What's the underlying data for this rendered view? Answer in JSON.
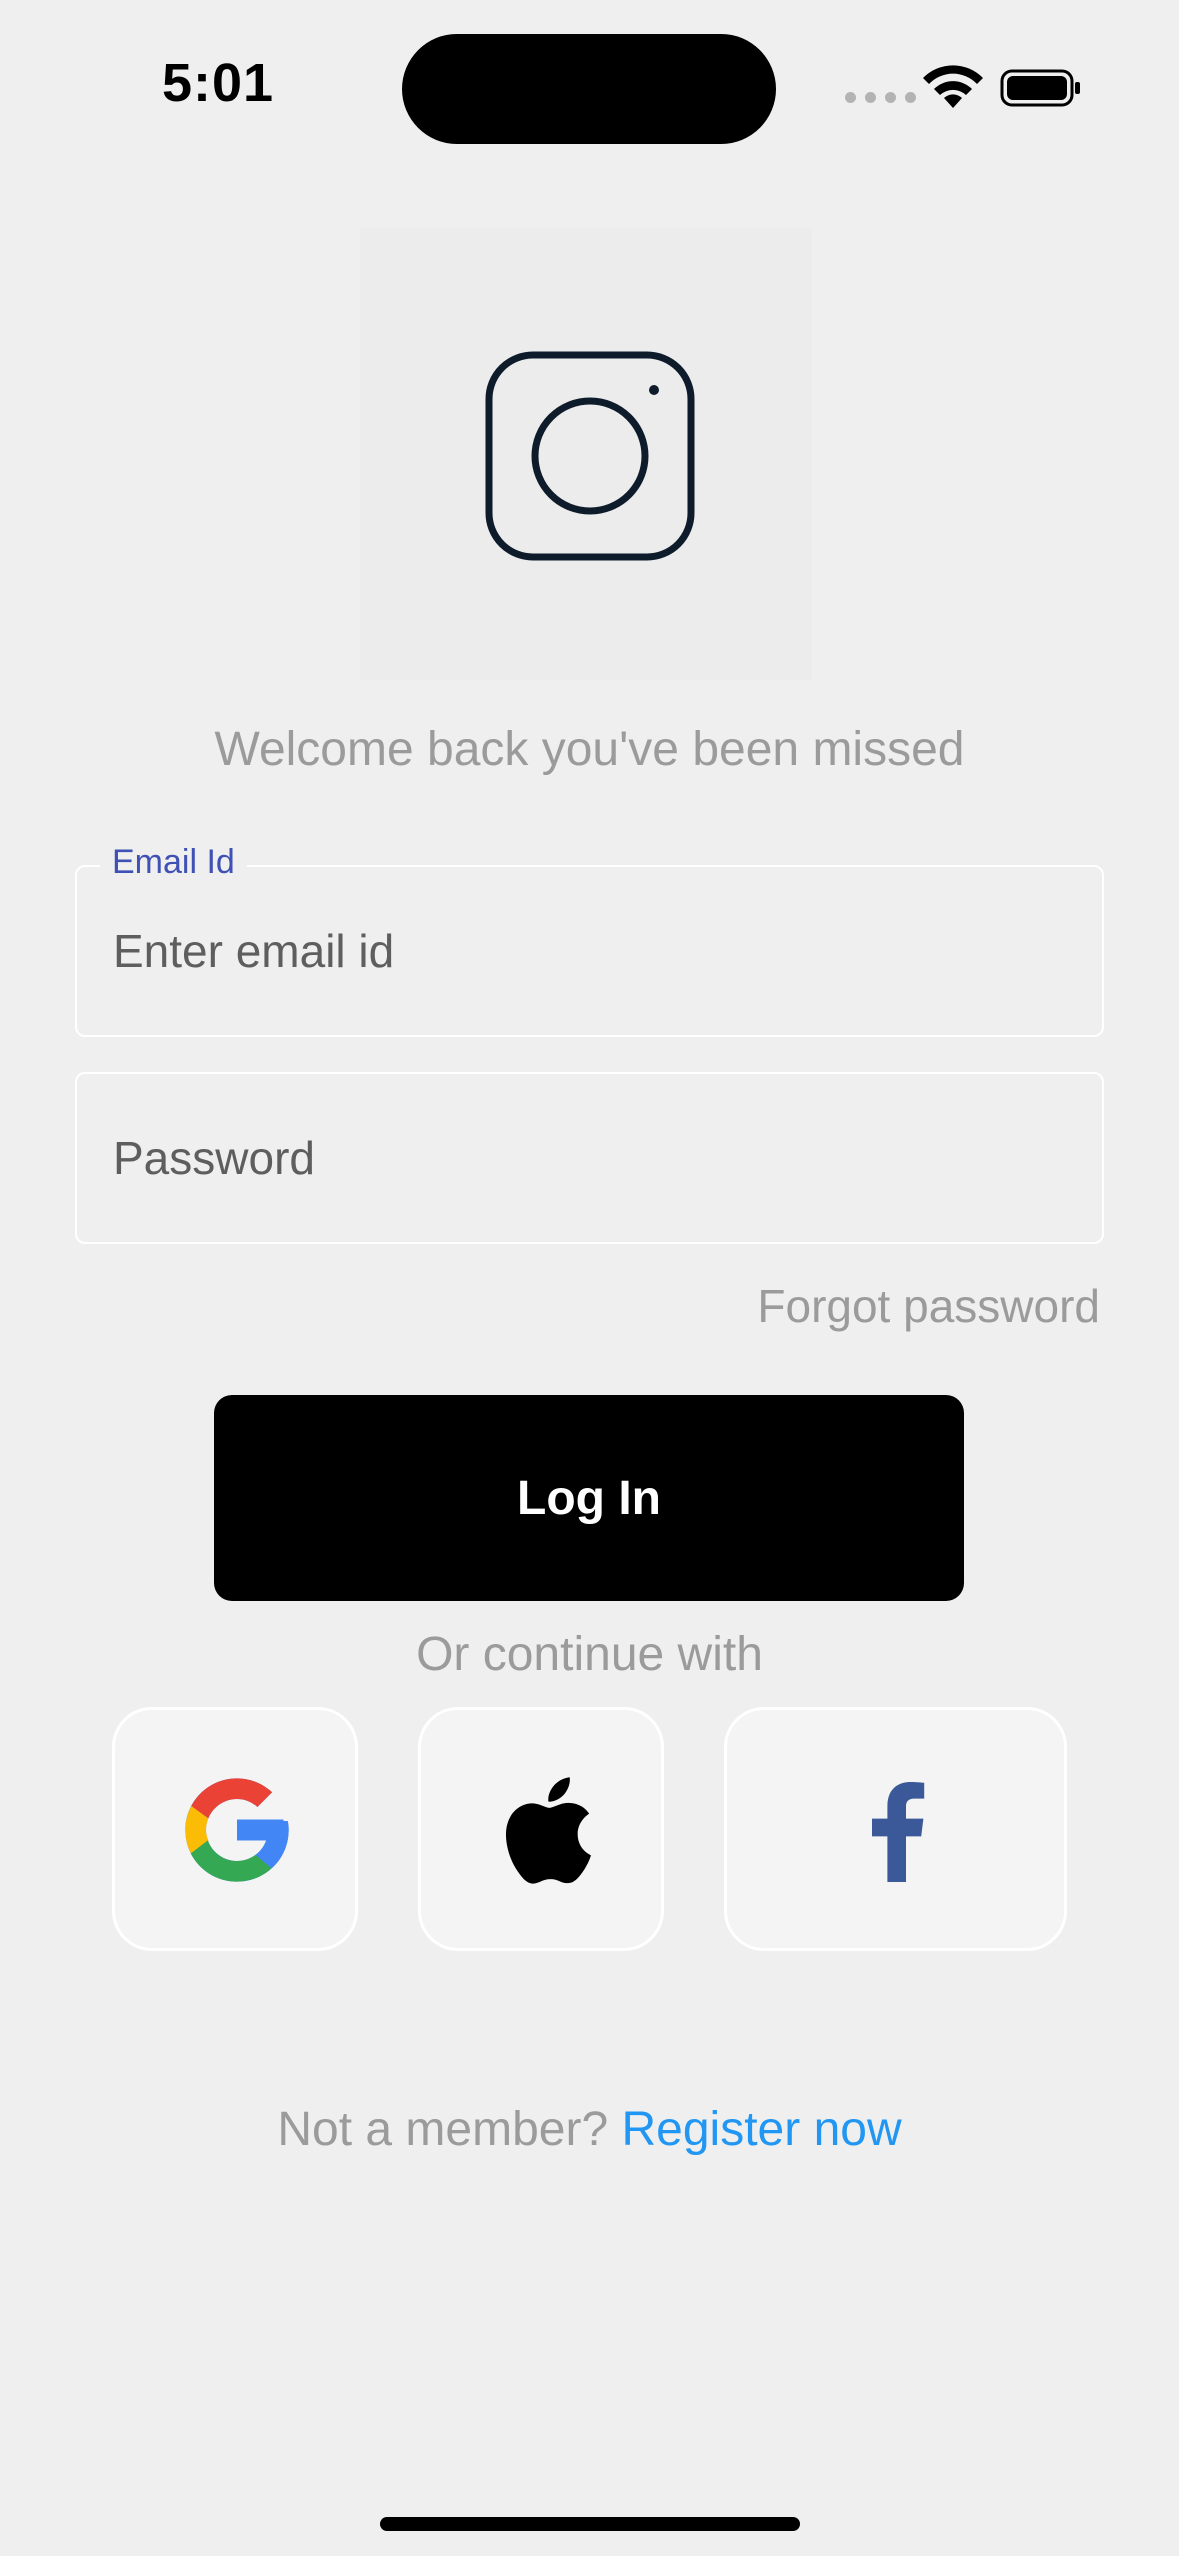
{
  "status_bar": {
    "time": "5:01"
  },
  "welcome_text": "Welcome back you've been missed",
  "email": {
    "label": "Email Id",
    "placeholder": "Enter email id",
    "value": ""
  },
  "password": {
    "placeholder": "Password",
    "value": ""
  },
  "forgot_password": "Forgot password",
  "login_label": "Log In",
  "divider_text": "Or continue with",
  "social": [
    {
      "icon": "google-icon"
    },
    {
      "icon": "apple-icon"
    },
    {
      "icon": "facebook-icon"
    }
  ],
  "footer": {
    "prompt": "Not a member?",
    "link": "Register now"
  },
  "colors": {
    "background": "#efefef",
    "primary_button": "#000000",
    "link": "#2196f3",
    "label_accent": "#3f51b5",
    "muted_text": "#9b9b9b",
    "facebook": "#3b5998"
  }
}
